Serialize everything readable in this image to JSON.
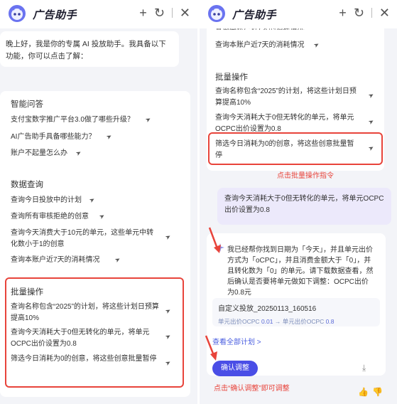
{
  "app": {
    "title": "广告助手"
  },
  "header_icons": {
    "plus": "+",
    "history": "↻",
    "close": "✕"
  },
  "left": {
    "welcome": "晚上好，我是你的专属 AI 投放助手。我具备以下功能，你可以点击了解：",
    "sections": [
      {
        "title": "智能问答",
        "items": [
          "支付宝数字推广平台3.0做了哪些升级？",
          "AI广告助手具备哪些能力？",
          "账户不起量怎么办"
        ]
      },
      {
        "title": "数据查询",
        "items": [
          "查询今日投放中的计划",
          "查询所有审核拒绝的创意",
          "查询今天消费大于10元的单元，这些单元中转化数小于1的创意",
          "查询本账户近7天的消耗情况"
        ]
      },
      {
        "title": "批量操作",
        "items": [
          "查询名称包含“2025”的计划，将这些计划日预算提高10%",
          "查询今天消耗大于0但无转化的单元，将单元OCPC出价设置为0.8",
          "筛选今日消耗为0的创意，将这些创意批量暂停"
        ]
      }
    ]
  },
  "right": {
    "cut_text": "查询本账户近7天的消耗情况",
    "cut_prev": "查询本账户近7天的消耗情况",
    "batch_title": "批量操作",
    "batch_items": [
      "查询名称包含“2025”的计划，将这些计划日预算提高10%",
      "查询今天消耗大于0但无转化的单元，将单元OCPC出价设置为0.8",
      "筛选今日消耗为0的创意，将这些创意批量暂停"
    ],
    "annot_click_batch": "点击批量操作指令",
    "user_message": "查询今天消耗大于0但无转化的单元，将单元OCPC出价设置为0.8",
    "bot_message": "我已经帮你找到日期为「今天」，并且单元出价方式为「oCPC」，并且消费金额大于「0」，并且转化数为「0」的单元。请下载数据查看，然后确认是否要将单元做如下调整：OCPC出价为0.8元",
    "result_name": "自定义投放_20250113_160516",
    "result_label_from": "单元出价OCPC",
    "result_value_from": "0.01",
    "result_label_to": "单元出价OCPC",
    "result_value_to": "0.8",
    "view_all_link": "查看全部计划 >",
    "confirm_button": "确认调整",
    "annot_confirm": "点击“确认调整”即可调整"
  }
}
